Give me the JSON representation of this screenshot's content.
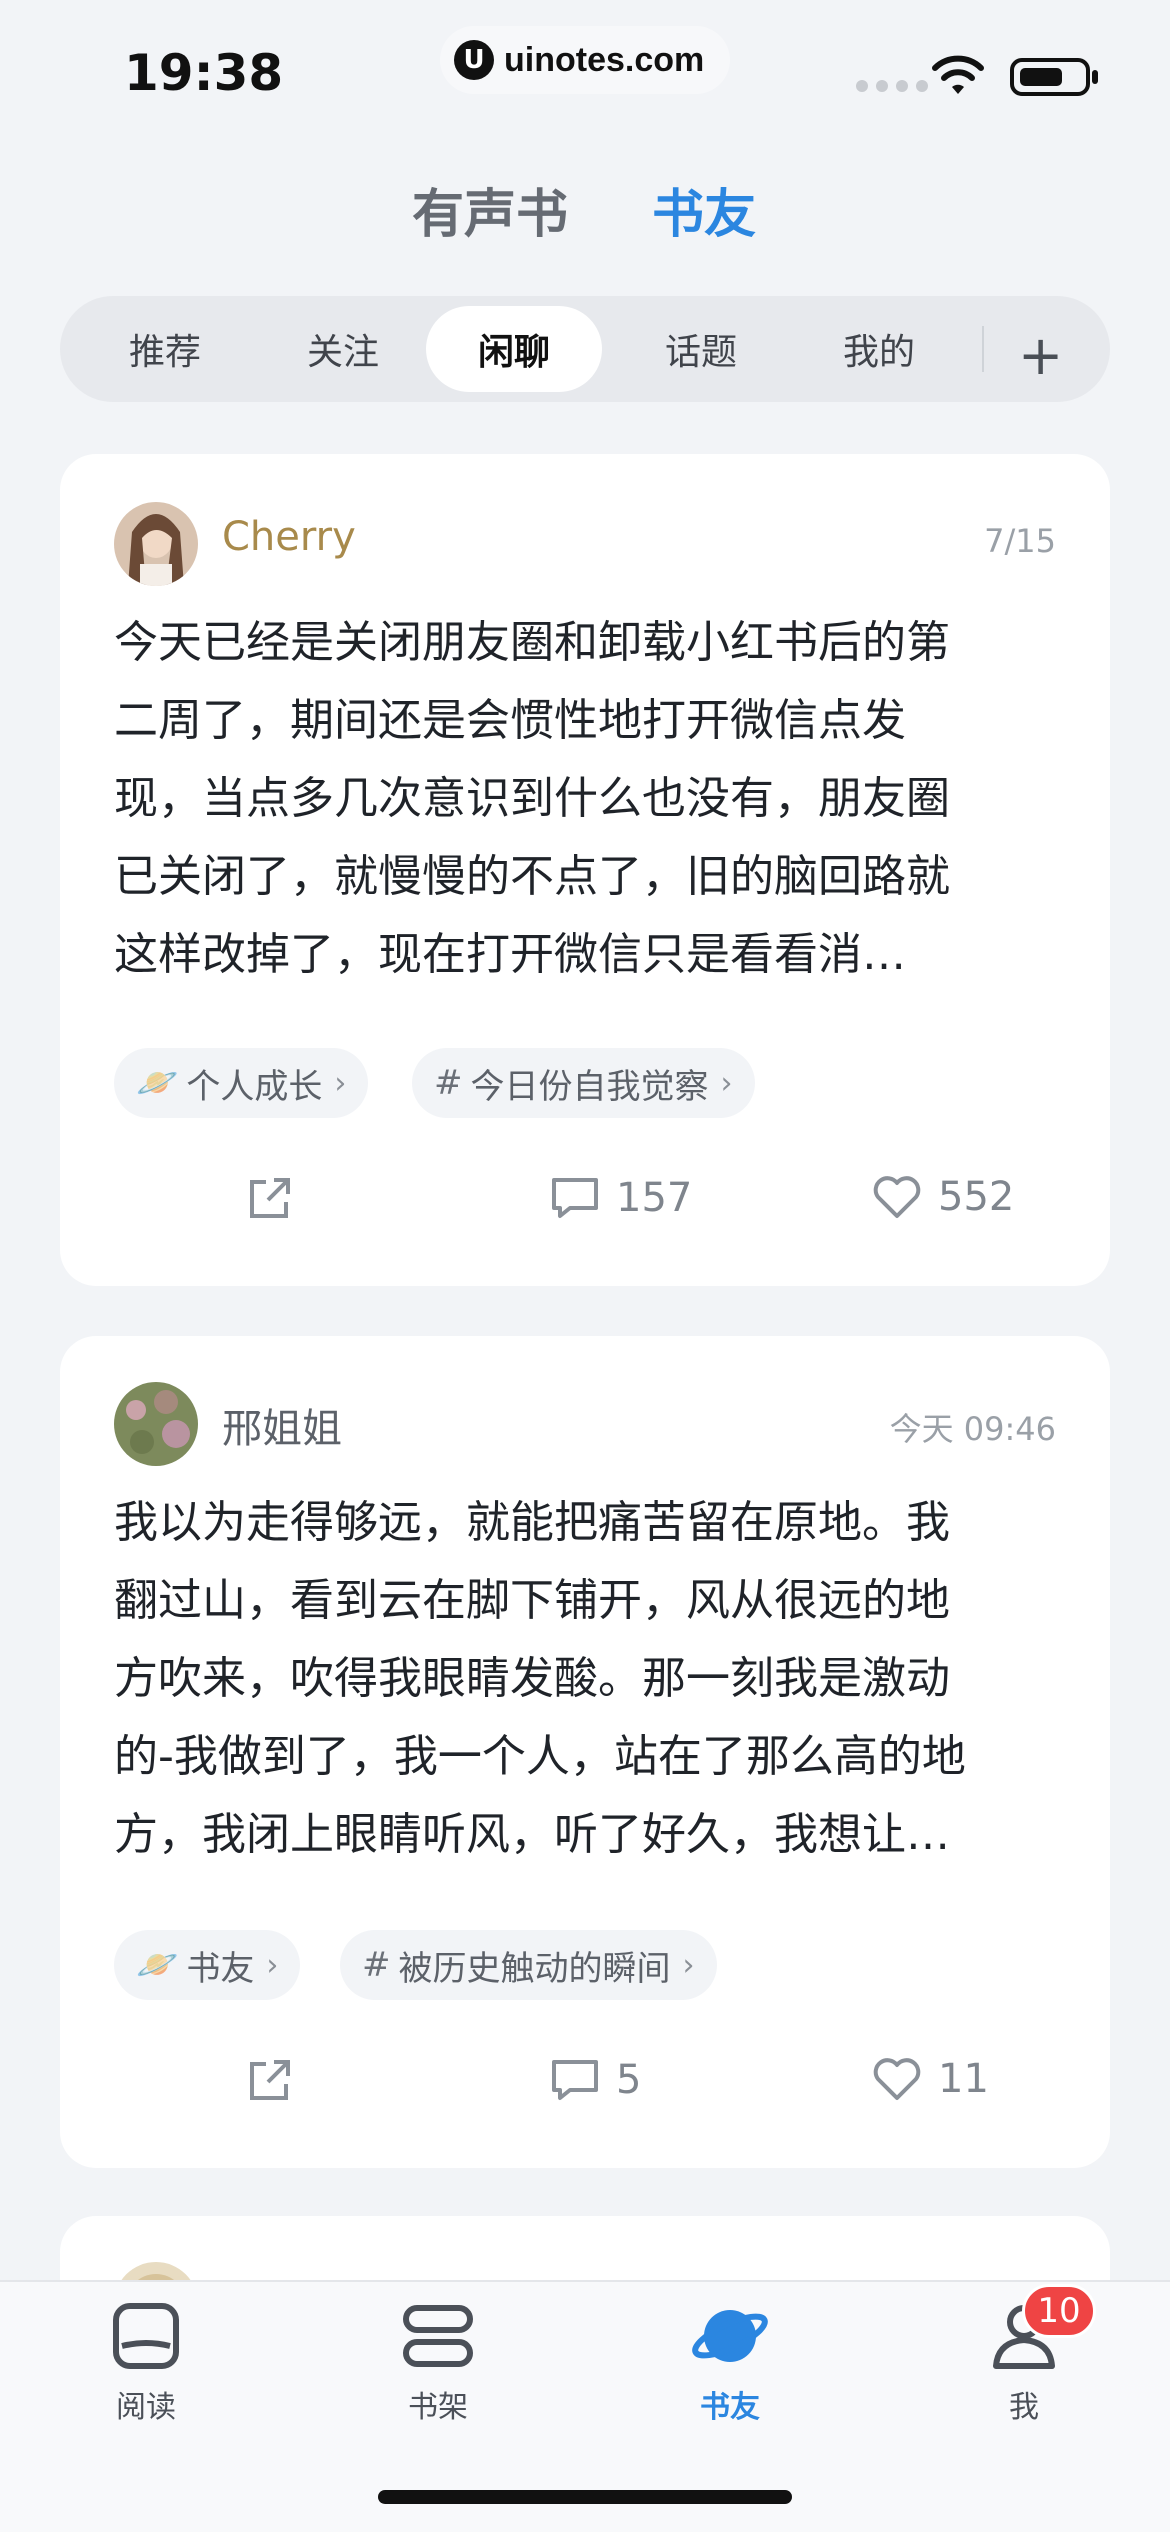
{
  "status_bar": {
    "time": "19:38",
    "url": "uinotes.com"
  },
  "top_tabs": [
    {
      "label": "有声书"
    },
    {
      "label": "书友"
    }
  ],
  "sub_tabs": [
    {
      "label": "推荐"
    },
    {
      "label": "关注"
    },
    {
      "label": "闲聊"
    },
    {
      "label": "话题"
    },
    {
      "label": "我的"
    }
  ],
  "posts": [
    {
      "user": "Cherry",
      "date": "7/15",
      "text_lines": [
        "今天已经是关闭朋友圈和卸载小红书后的第",
        "二周了，期间还是会惯性地打开微信点发",
        "现，当点多几次意识到什么也没有，朋友圈",
        "已关闭了，就慢慢的不点了，旧的脑回路就",
        "这样改掉了，现在打开微信只是看看消…"
      ],
      "chips": [
        {
          "icon": "planet-icon",
          "label": "个人成长"
        },
        {
          "icon": "hash-icon",
          "label": "今日份自我觉察"
        }
      ],
      "comments": "157",
      "likes": "552"
    },
    {
      "user": "邢姐姐",
      "date": "今天 09:46",
      "text_lines": [
        "我以为走得够远，就能把痛苦留在原地。我",
        "翻过山，看到云在脚下铺开，风从很远的地",
        "方吹来，吹得我眼睛发酸。那一刻我是激动",
        "的-我做到了，我一个人，站在了那么高的地",
        "方，我闭上眼睛听风，听了好久，我想让…"
      ],
      "chips": [
        {
          "icon": "planet-icon",
          "label": "书友"
        },
        {
          "icon": "hash-icon",
          "label": "被历史触动的瞬间"
        }
      ],
      "comments": "5",
      "likes": "11"
    }
  ],
  "bottom_nav": [
    {
      "label": "阅读",
      "icon": "book-open-icon"
    },
    {
      "label": "书架",
      "icon": "bookshelf-icon"
    },
    {
      "label": "书友",
      "icon": "planet-icon"
    },
    {
      "label": "我",
      "icon": "profile-icon",
      "badge": "10"
    }
  ],
  "colors": {
    "accent": "#2b86e0",
    "username_gold": "#a88a4b",
    "badge_red": "#ef4444"
  }
}
